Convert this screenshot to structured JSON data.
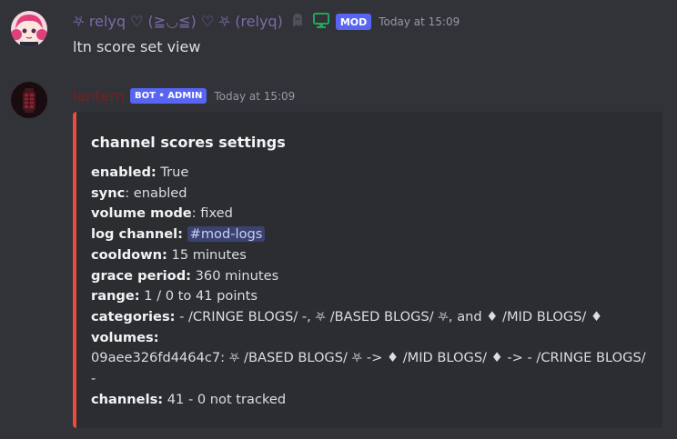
{
  "messages": [
    {
      "author": "⛧ relyq ♡ (≧◡≦) ♡ ⛧ (relyq)",
      "ghost_icon": "ghost-icon",
      "device_icon": "desktop-icon",
      "badge": "MOD",
      "timestamp": "Today at 15:09",
      "content": "ltn score set view"
    },
    {
      "author": "lantern",
      "badge": "BOT • ADMIN",
      "timestamp": "Today at 15:09",
      "embed": {
        "accent_color": "#e74c3c",
        "title": "channel scores settings",
        "fields": {
          "enabled_label": "enabled:",
          "enabled_value": " True",
          "sync_label": "sync",
          "sync_value": ": enabled",
          "volume_mode_label": "volume mode",
          "volume_mode_value": ": fixed",
          "log_channel_label": "log channel:",
          "log_channel_value": "#mod-logs",
          "cooldown_label": "cooldown:",
          "cooldown_value": " 15 minutes",
          "grace_period_label": "grace period:",
          "grace_period_value": " 360 minutes",
          "range_label": "range:",
          "range_value": " 1 / 0 to 41 points",
          "categories_label": "categories:",
          "categories_value": " - /CRINGE BLOGS/ -, ⛧ /BASED BLOGS/ ⛧, and ♦ /MID BLOGS/ ♦",
          "volumes_label": "volumes:",
          "volumes_value": "09aee326fd4464c7: ⛧ /BASED BLOGS/ ⛧ -> ♦ /MID BLOGS/ ♦ -> - /CRINGE BLOGS/ -",
          "channels_label": "channels:",
          "channels_value": " 41 - 0 not tracked"
        }
      }
    }
  ],
  "colors": {
    "background": "#313338",
    "mod_author": "#7c6aa8",
    "bot_author": "#7a1e1e",
    "badge_bg": "#5865f2",
    "online_desktop": "#23a55a"
  }
}
